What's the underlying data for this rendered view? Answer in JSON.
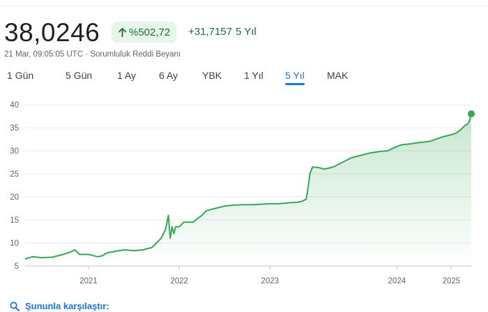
{
  "quote": {
    "price": "38,0246",
    "percent_change": "%502,72",
    "abs_change": "+31,7157",
    "period": "5 Yıl",
    "timestamp": "21 Mar, 09:05:05 UTC · Sorumluluk Reddi Beyanı"
  },
  "tabs": [
    {
      "label": "1 Gün",
      "active": false
    },
    {
      "label": "5 Gün",
      "active": false
    },
    {
      "label": "1 Ay",
      "active": false
    },
    {
      "label": "6 Ay",
      "active": false
    },
    {
      "label": "YBK",
      "active": false
    },
    {
      "label": "1 Yıl",
      "active": false
    },
    {
      "label": "5 Yıl",
      "active": true
    },
    {
      "label": "MAK",
      "active": false
    }
  ],
  "compare": {
    "label": "Şununla karşılaştır:"
  },
  "colors": {
    "up": "#137333",
    "line": "#34a853",
    "accent": "#1a73e8",
    "grid": "#e8eaed"
  },
  "icons": {
    "change_arrow": "arrow-up-icon",
    "compare": "search-icon"
  },
  "chart_data": {
    "type": "area",
    "ylim": [
      5,
      40
    ],
    "yticks": [
      5,
      10,
      15,
      20,
      25,
      30,
      35,
      40
    ],
    "xlim": [
      2020.3,
      2025.22
    ],
    "xticks": [
      {
        "label": "2021",
        "x": 2021.0
      },
      {
        "label": "2022",
        "x": 2022.0
      },
      {
        "label": "2023",
        "x": 2023.0
      },
      {
        "label": "2024",
        "x": 2024.4
      },
      {
        "label": "2025",
        "x": 2025.0
      }
    ],
    "grid": true,
    "x": [
      2020.3,
      2020.38,
      2020.48,
      2020.6,
      2020.72,
      2020.8,
      2020.85,
      2020.9,
      2021.0,
      2021.1,
      2021.15,
      2021.2,
      2021.3,
      2021.4,
      2021.5,
      2021.6,
      2021.7,
      2021.75,
      2021.8,
      2021.85,
      2021.88,
      2021.9,
      2021.92,
      2021.94,
      2021.96,
      2022.0,
      2022.05,
      2022.15,
      2022.25,
      2022.3,
      2022.4,
      2022.5,
      2022.6,
      2022.7,
      2022.8,
      2022.9,
      2023.0,
      2023.1,
      2023.2,
      2023.3,
      2023.35,
      2023.4,
      2023.42,
      2023.44,
      2023.47,
      2023.55,
      2023.6,
      2023.7,
      2023.8,
      2023.9,
      2024.0,
      2024.1,
      2024.2,
      2024.3,
      2024.35,
      2024.45,
      2024.55,
      2024.65,
      2024.75,
      2024.8,
      2024.9,
      2025.0,
      2025.05,
      2025.1,
      2025.15,
      2025.18,
      2025.2,
      2025.22
    ],
    "values": [
      6.5,
      7.0,
      6.8,
      6.9,
      7.5,
      8.0,
      8.5,
      7.5,
      7.5,
      7.0,
      7.2,
      7.8,
      8.2,
      8.5,
      8.3,
      8.5,
      9.0,
      10.0,
      11.0,
      13.0,
      16.0,
      11.0,
      13.5,
      12.0,
      13.5,
      13.5,
      14.5,
      14.5,
      16.0,
      17.0,
      17.5,
      18.0,
      18.2,
      18.3,
      18.3,
      18.4,
      18.5,
      18.5,
      18.7,
      18.8,
      19.0,
      19.5,
      22.0,
      25.0,
      26.5,
      26.3,
      26.0,
      26.5,
      27.5,
      28.5,
      29.0,
      29.5,
      29.8,
      30.0,
      30.5,
      31.3,
      31.5,
      31.8,
      32.0,
      32.3,
      33.0,
      33.5,
      33.8,
      34.5,
      35.5,
      35.8,
      36.5,
      38.02
    ]
  }
}
